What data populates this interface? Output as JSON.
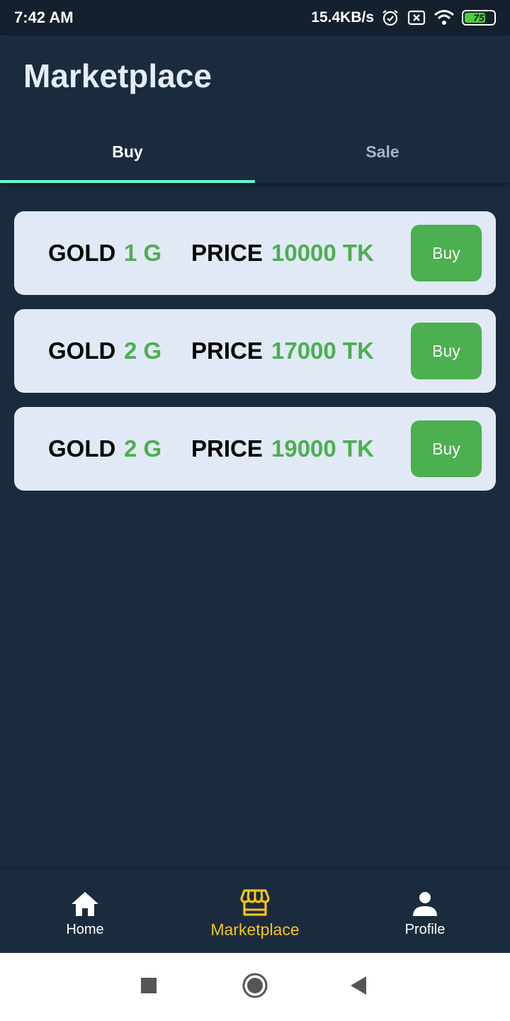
{
  "status_bar": {
    "time": "7:42 AM",
    "network_speed": "15.4KB/s",
    "battery_level": "75",
    "icons": [
      "alarm-icon",
      "sim-off-icon",
      "wifi-icon",
      "battery-icon"
    ]
  },
  "header": {
    "title": "Marketplace"
  },
  "tabs": [
    {
      "label": "Buy",
      "active": true
    },
    {
      "label": "Sale",
      "active": false
    }
  ],
  "listings": [
    {
      "gold_label": "GOLD",
      "quantity": "1 G",
      "price_label": "PRICE",
      "price": "10000 TK",
      "button_label": "Buy"
    },
    {
      "gold_label": "GOLD",
      "quantity": "2 G",
      "price_label": "PRICE",
      "price": "17000 TK",
      "button_label": "Buy"
    },
    {
      "gold_label": "GOLD",
      "quantity": "2 G",
      "price_label": "PRICE",
      "price": "19000 TK",
      "button_label": "Buy"
    }
  ],
  "bottom_nav": [
    {
      "label": "Home",
      "icon": "home-icon",
      "active": false
    },
    {
      "label": "Marketplace",
      "icon": "store-icon",
      "active": true
    },
    {
      "label": "Profile",
      "icon": "person-icon",
      "active": false
    }
  ],
  "system_nav": [
    "recents-button",
    "home-button",
    "back-button"
  ],
  "colors": {
    "background": "#1b2b3e",
    "card": "#e1e9f6",
    "accent_green": "#4caf50",
    "tab_indicator": "#64ffda",
    "active_nav": "#f5c518"
  }
}
